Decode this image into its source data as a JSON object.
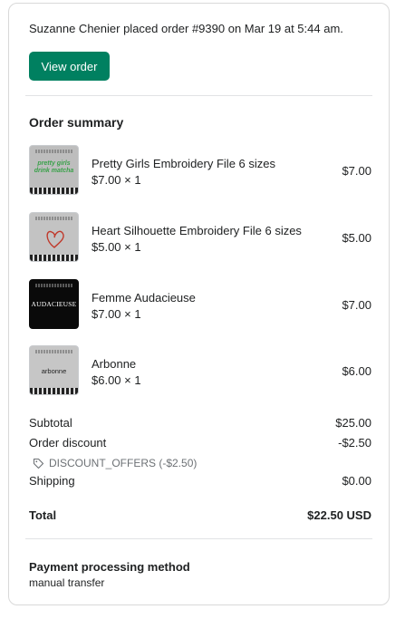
{
  "notice": {
    "headline": "Suzanne Chenier placed order #9390 on Mar 19 at 5:44 am.",
    "view_order_label": "View order"
  },
  "summary": {
    "title": "Order summary",
    "items": [
      {
        "name": "Pretty Girls Embroidery File 6 sizes",
        "qty": "$7.00 × 1",
        "price": "$7.00",
        "thumb_text": "pretty girls drink matcha",
        "thumb_bg": "#bdbdbd",
        "thumb_fg": "#3aa14a",
        "icon": "matcha-design-icon"
      },
      {
        "name": "Heart Silhouette Embroidery File 6 sizes",
        "qty": "$5.00 × 1",
        "price": "$5.00",
        "thumb_text": "",
        "thumb_bg": "#c3c3c3",
        "thumb_fg": "#c0392b",
        "icon": "heart-icon"
      },
      {
        "name": "Femme Audacieuse",
        "qty": "$7.00 × 1",
        "price": "$7.00",
        "thumb_text": "AUDACIEUSE",
        "thumb_bg": "#0a0a0a",
        "thumb_fg": "#ffffff",
        "icon": "text-design-icon"
      },
      {
        "name": "Arbonne",
        "qty": "$6.00 × 1",
        "price": "$6.00",
        "thumb_text": "arbonne",
        "thumb_bg": "#c6c6c6",
        "thumb_fg": "#222222",
        "icon": "arbonne-logo-icon"
      }
    ]
  },
  "totals": {
    "subtotal_label": "Subtotal",
    "subtotal_value": "$25.00",
    "discount_label": "Order discount",
    "discount_value": "-$2.50",
    "discount_code": "DISCOUNT_OFFERS (-$2.50)",
    "shipping_label": "Shipping",
    "shipping_value": "$0.00",
    "total_label": "Total",
    "total_value": "$22.50 USD"
  },
  "payment": {
    "title": "Payment processing method",
    "method": "manual transfer"
  },
  "colors": {
    "primary_button": "#008060",
    "border": "#d9d9d9",
    "muted_text": "#6d7175"
  }
}
